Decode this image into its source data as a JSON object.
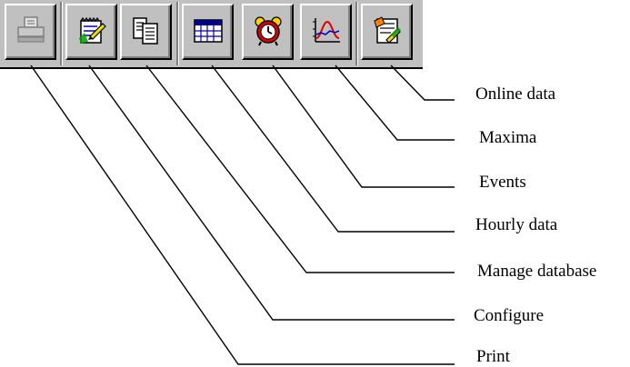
{
  "toolbar": {
    "buttons": [
      {
        "id": "print",
        "icon": "printer-icon"
      },
      {
        "id": "configure",
        "icon": "edit-document-icon"
      },
      {
        "id": "manage-database",
        "icon": "copy-pages-icon"
      },
      {
        "id": "hourly-data",
        "icon": "table-icon"
      },
      {
        "id": "events",
        "icon": "alarm-clock-icon"
      },
      {
        "id": "maxima",
        "icon": "curve-chart-icon"
      },
      {
        "id": "online-data",
        "icon": "online-pen-icon"
      }
    ]
  },
  "labels": {
    "online_data": "Online data",
    "maxima": "Maxima",
    "events": "Events",
    "hourly_data": "Hourly data",
    "manage_database": "Manage database",
    "configure": "Configure",
    "print": "Print"
  }
}
